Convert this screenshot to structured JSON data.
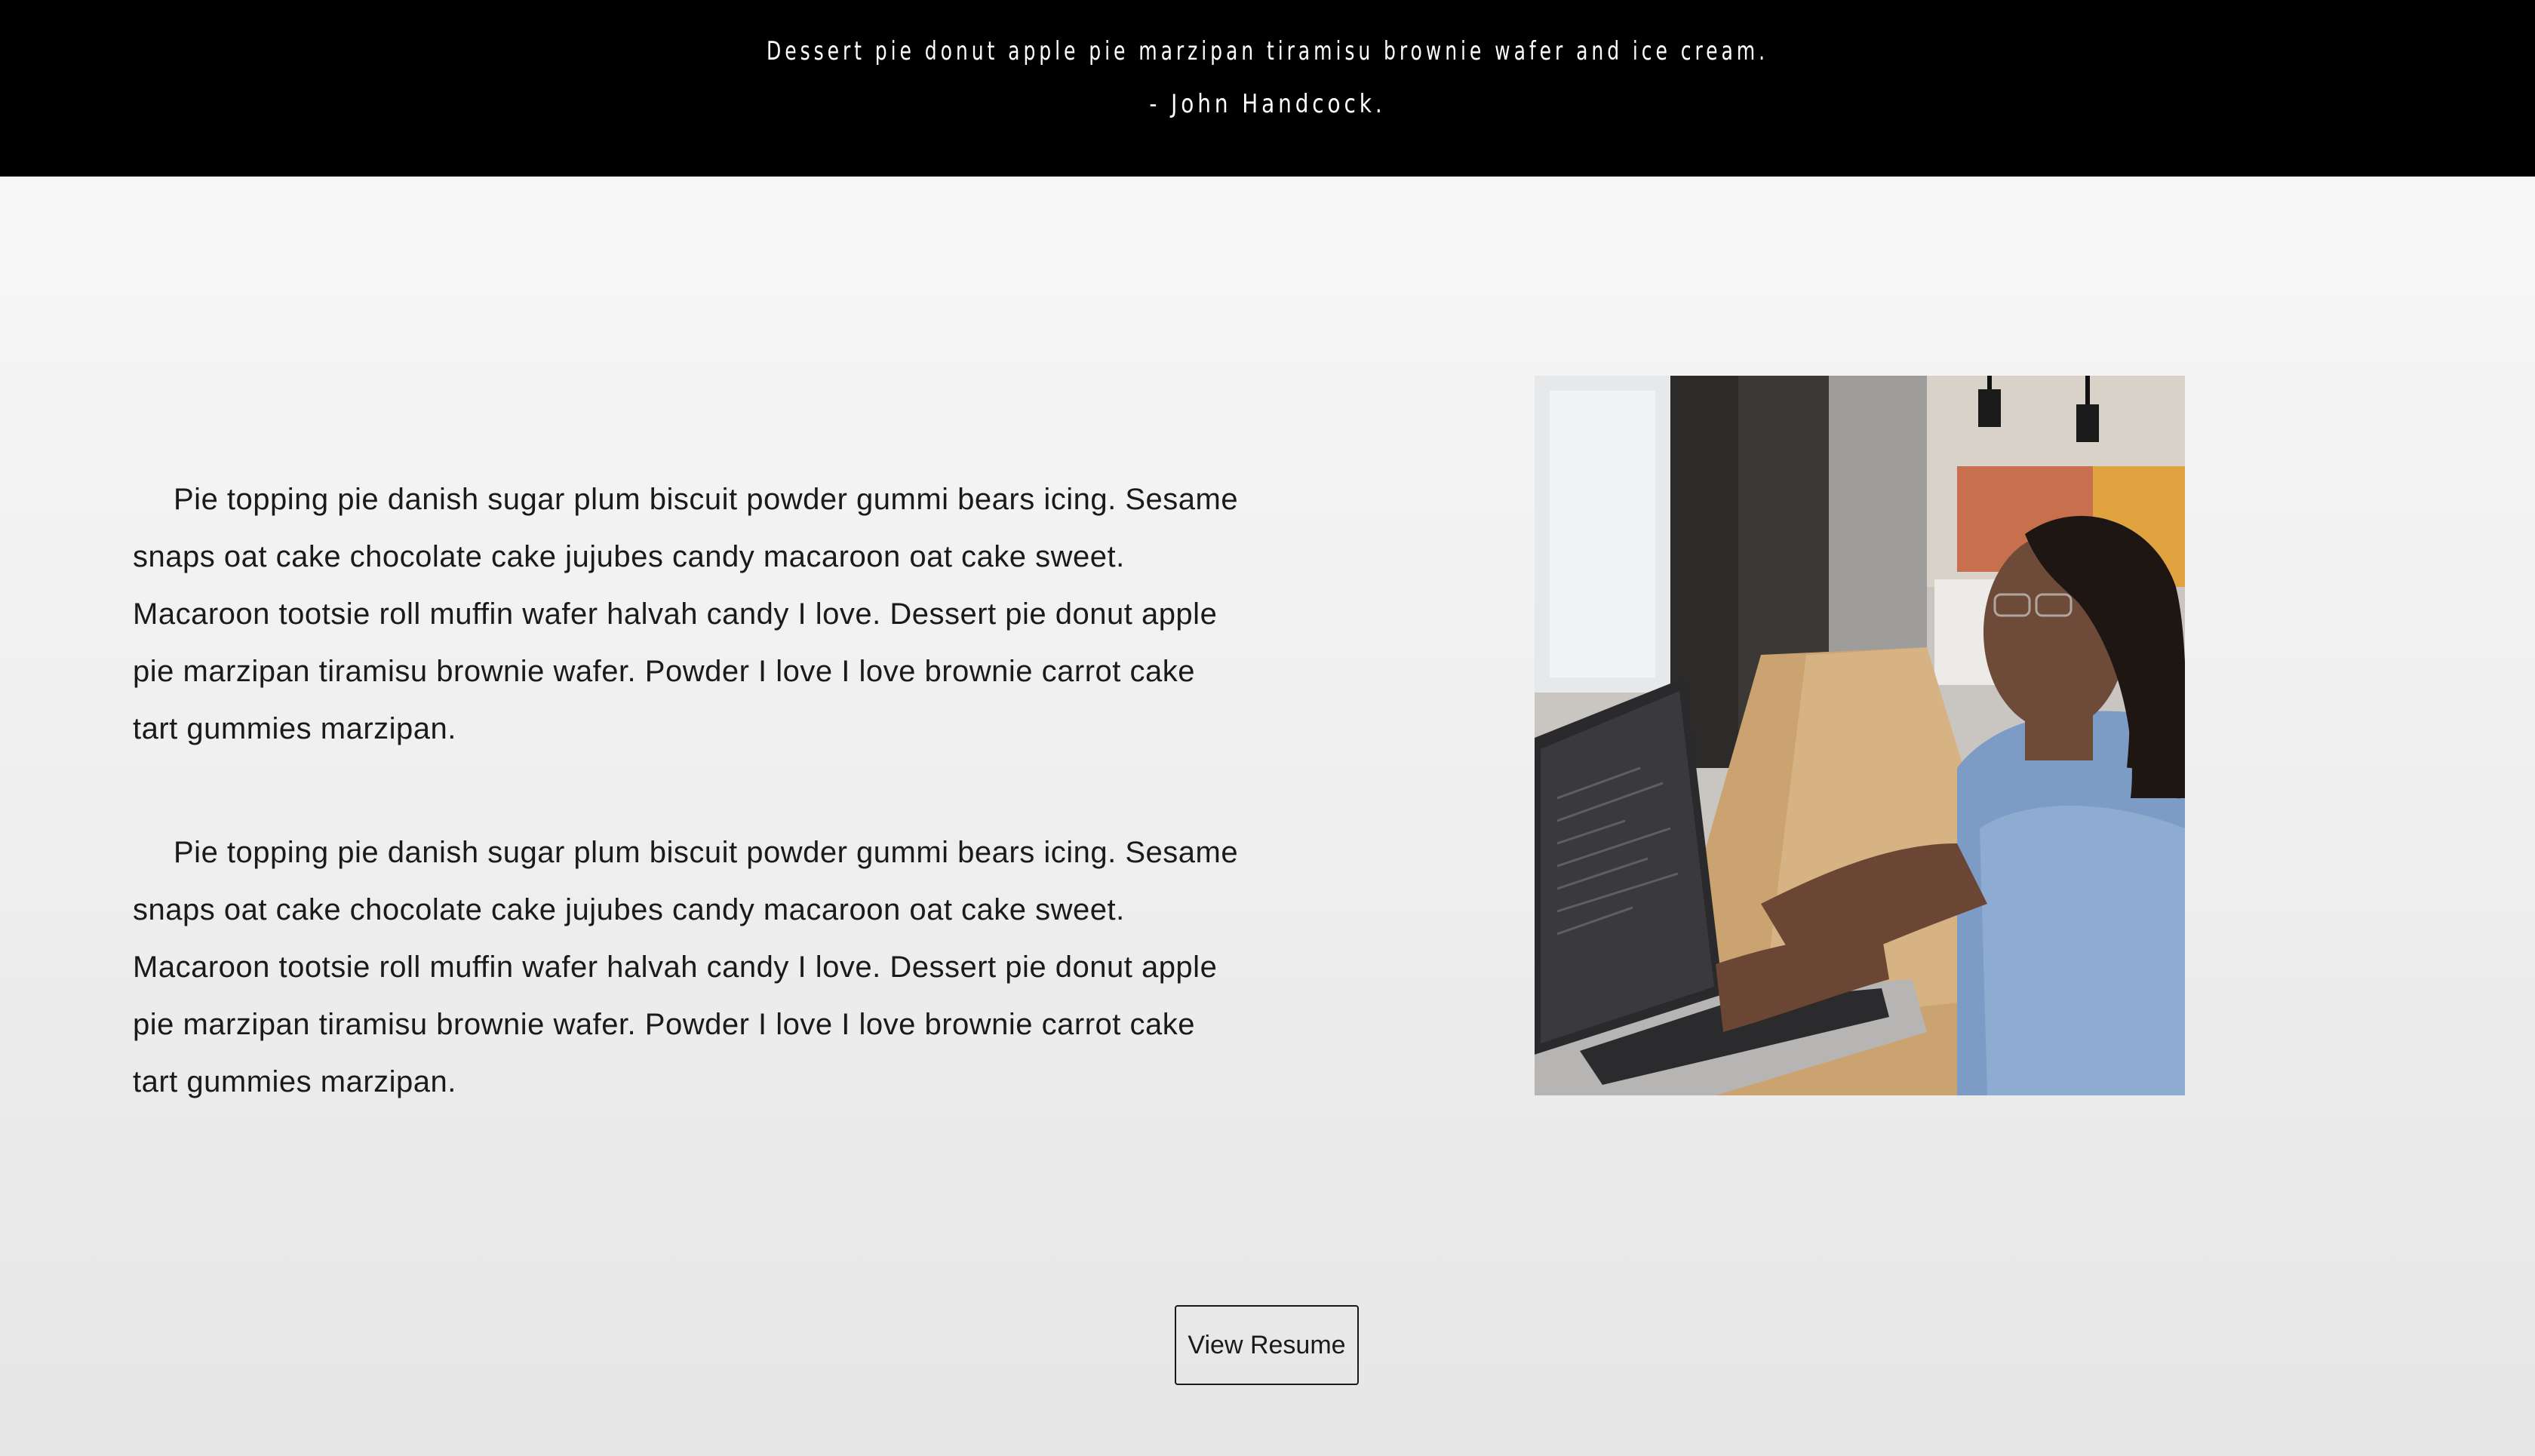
{
  "quote": {
    "text": "Dessert pie donut apple pie marzipan tiramisu brownie wafer and ice cream.",
    "author": "- John Handcock."
  },
  "about": {
    "paragraphs": [
      "Pie topping pie danish sugar plum biscuit powder gummi bears icing. Sesame snaps oat cake chocolate cake jujubes candy macaroon oat cake sweet. Macaroon tootsie roll muffin wafer halvah candy I love. Dessert pie donut apple pie marzipan tiramisu brownie wafer. Powder I love I love brownie carrot cake tart gummies marzipan.",
      "Pie topping pie danish sugar plum biscuit powder gummi bears icing. Sesame snaps oat cake chocolate cake jujubes candy macaroon oat cake sweet. Macaroon tootsie roll muffin wafer halvah candy I love. Dessert pie donut apple pie marzipan tiramisu brownie wafer. Powder I love I love brownie carrot cake tart gummies marzipan."
    ],
    "photo_icon": "person-at-laptop-photo"
  },
  "actions": {
    "resume_label": "View Resume"
  },
  "colors": {
    "banner_bg": "#000000",
    "banner_text": "#ffffff",
    "body_text": "#1a1a1a",
    "page_bg": "#efefef"
  }
}
